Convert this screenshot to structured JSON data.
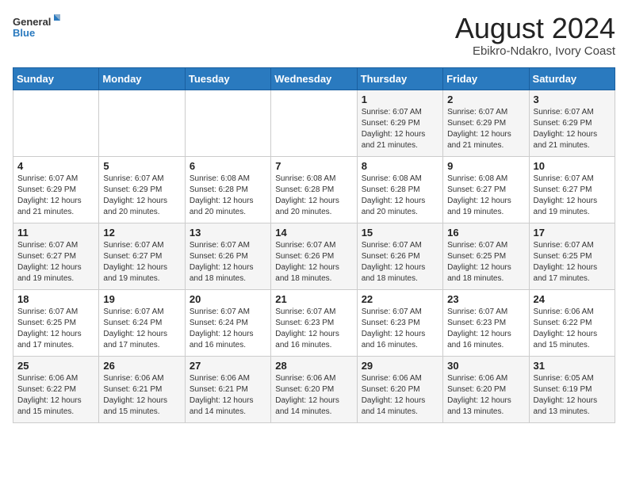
{
  "header": {
    "logo_line1": "General",
    "logo_line2": "Blue",
    "month_year": "August 2024",
    "location": "Ebikro-Ndakro, Ivory Coast"
  },
  "days_of_week": [
    "Sunday",
    "Monday",
    "Tuesday",
    "Wednesday",
    "Thursday",
    "Friday",
    "Saturday"
  ],
  "weeks": [
    [
      {
        "day": "",
        "info": ""
      },
      {
        "day": "",
        "info": ""
      },
      {
        "day": "",
        "info": ""
      },
      {
        "day": "",
        "info": ""
      },
      {
        "day": "1",
        "info": "Sunrise: 6:07 AM\nSunset: 6:29 PM\nDaylight: 12 hours\nand 21 minutes."
      },
      {
        "day": "2",
        "info": "Sunrise: 6:07 AM\nSunset: 6:29 PM\nDaylight: 12 hours\nand 21 minutes."
      },
      {
        "day": "3",
        "info": "Sunrise: 6:07 AM\nSunset: 6:29 PM\nDaylight: 12 hours\nand 21 minutes."
      }
    ],
    [
      {
        "day": "4",
        "info": "Sunrise: 6:07 AM\nSunset: 6:29 PM\nDaylight: 12 hours\nand 21 minutes."
      },
      {
        "day": "5",
        "info": "Sunrise: 6:07 AM\nSunset: 6:29 PM\nDaylight: 12 hours\nand 20 minutes."
      },
      {
        "day": "6",
        "info": "Sunrise: 6:08 AM\nSunset: 6:28 PM\nDaylight: 12 hours\nand 20 minutes."
      },
      {
        "day": "7",
        "info": "Sunrise: 6:08 AM\nSunset: 6:28 PM\nDaylight: 12 hours\nand 20 minutes."
      },
      {
        "day": "8",
        "info": "Sunrise: 6:08 AM\nSunset: 6:28 PM\nDaylight: 12 hours\nand 20 minutes."
      },
      {
        "day": "9",
        "info": "Sunrise: 6:08 AM\nSunset: 6:27 PM\nDaylight: 12 hours\nand 19 minutes."
      },
      {
        "day": "10",
        "info": "Sunrise: 6:07 AM\nSunset: 6:27 PM\nDaylight: 12 hours\nand 19 minutes."
      }
    ],
    [
      {
        "day": "11",
        "info": "Sunrise: 6:07 AM\nSunset: 6:27 PM\nDaylight: 12 hours\nand 19 minutes."
      },
      {
        "day": "12",
        "info": "Sunrise: 6:07 AM\nSunset: 6:27 PM\nDaylight: 12 hours\nand 19 minutes."
      },
      {
        "day": "13",
        "info": "Sunrise: 6:07 AM\nSunset: 6:26 PM\nDaylight: 12 hours\nand 18 minutes."
      },
      {
        "day": "14",
        "info": "Sunrise: 6:07 AM\nSunset: 6:26 PM\nDaylight: 12 hours\nand 18 minutes."
      },
      {
        "day": "15",
        "info": "Sunrise: 6:07 AM\nSunset: 6:26 PM\nDaylight: 12 hours\nand 18 minutes."
      },
      {
        "day": "16",
        "info": "Sunrise: 6:07 AM\nSunset: 6:25 PM\nDaylight: 12 hours\nand 18 minutes."
      },
      {
        "day": "17",
        "info": "Sunrise: 6:07 AM\nSunset: 6:25 PM\nDaylight: 12 hours\nand 17 minutes."
      }
    ],
    [
      {
        "day": "18",
        "info": "Sunrise: 6:07 AM\nSunset: 6:25 PM\nDaylight: 12 hours\nand 17 minutes."
      },
      {
        "day": "19",
        "info": "Sunrise: 6:07 AM\nSunset: 6:24 PM\nDaylight: 12 hours\nand 17 minutes."
      },
      {
        "day": "20",
        "info": "Sunrise: 6:07 AM\nSunset: 6:24 PM\nDaylight: 12 hours\nand 16 minutes."
      },
      {
        "day": "21",
        "info": "Sunrise: 6:07 AM\nSunset: 6:23 PM\nDaylight: 12 hours\nand 16 minutes."
      },
      {
        "day": "22",
        "info": "Sunrise: 6:07 AM\nSunset: 6:23 PM\nDaylight: 12 hours\nand 16 minutes."
      },
      {
        "day": "23",
        "info": "Sunrise: 6:07 AM\nSunset: 6:23 PM\nDaylight: 12 hours\nand 16 minutes."
      },
      {
        "day": "24",
        "info": "Sunrise: 6:06 AM\nSunset: 6:22 PM\nDaylight: 12 hours\nand 15 minutes."
      }
    ],
    [
      {
        "day": "25",
        "info": "Sunrise: 6:06 AM\nSunset: 6:22 PM\nDaylight: 12 hours\nand 15 minutes."
      },
      {
        "day": "26",
        "info": "Sunrise: 6:06 AM\nSunset: 6:21 PM\nDaylight: 12 hours\nand 15 minutes."
      },
      {
        "day": "27",
        "info": "Sunrise: 6:06 AM\nSunset: 6:21 PM\nDaylight: 12 hours\nand 14 minutes."
      },
      {
        "day": "28",
        "info": "Sunrise: 6:06 AM\nSunset: 6:20 PM\nDaylight: 12 hours\nand 14 minutes."
      },
      {
        "day": "29",
        "info": "Sunrise: 6:06 AM\nSunset: 6:20 PM\nDaylight: 12 hours\nand 14 minutes."
      },
      {
        "day": "30",
        "info": "Sunrise: 6:06 AM\nSunset: 6:20 PM\nDaylight: 12 hours\nand 13 minutes."
      },
      {
        "day": "31",
        "info": "Sunrise: 6:05 AM\nSunset: 6:19 PM\nDaylight: 12 hours\nand 13 minutes."
      }
    ]
  ]
}
